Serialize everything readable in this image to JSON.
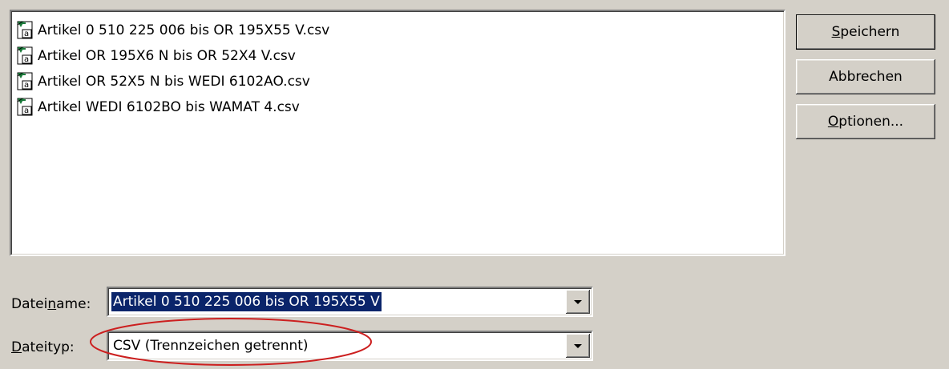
{
  "file_list": {
    "items": [
      {
        "name": "Artikel 0 510 225 006 bis OR 195X55 V.csv",
        "icon": "csv-file-icon"
      },
      {
        "name": "Artikel OR 195X6 N bis OR 52X4 V.csv",
        "icon": "csv-file-icon"
      },
      {
        "name": "Artikel OR 52X5 N bis WEDI 6102AO.csv",
        "icon": "csv-file-icon"
      },
      {
        "name": "Artikel WEDI 6102BO bis WAMAT 4.csv",
        "icon": "csv-file-icon"
      }
    ]
  },
  "buttons": {
    "save": {
      "mnemonic": "S",
      "rest": "peichern"
    },
    "cancel": {
      "label": "Abbrechen"
    },
    "options": {
      "mnemonic": "O",
      "rest": "ptionen..."
    }
  },
  "filename": {
    "label_pre": "Datei",
    "label_mnemonic": "n",
    "label_post": "ame:",
    "value": "Artikel 0 510 225 006 bis OR 195X55 V"
  },
  "filetype": {
    "label_mnemonic": "D",
    "label_post": "ateityp:",
    "value": "CSV (Trennzeichen getrennt)"
  },
  "colors": {
    "dialog_bg": "#d4d0c8",
    "selection_bg": "#0a246a",
    "annotation_ellipse": "#cc1f1f"
  }
}
